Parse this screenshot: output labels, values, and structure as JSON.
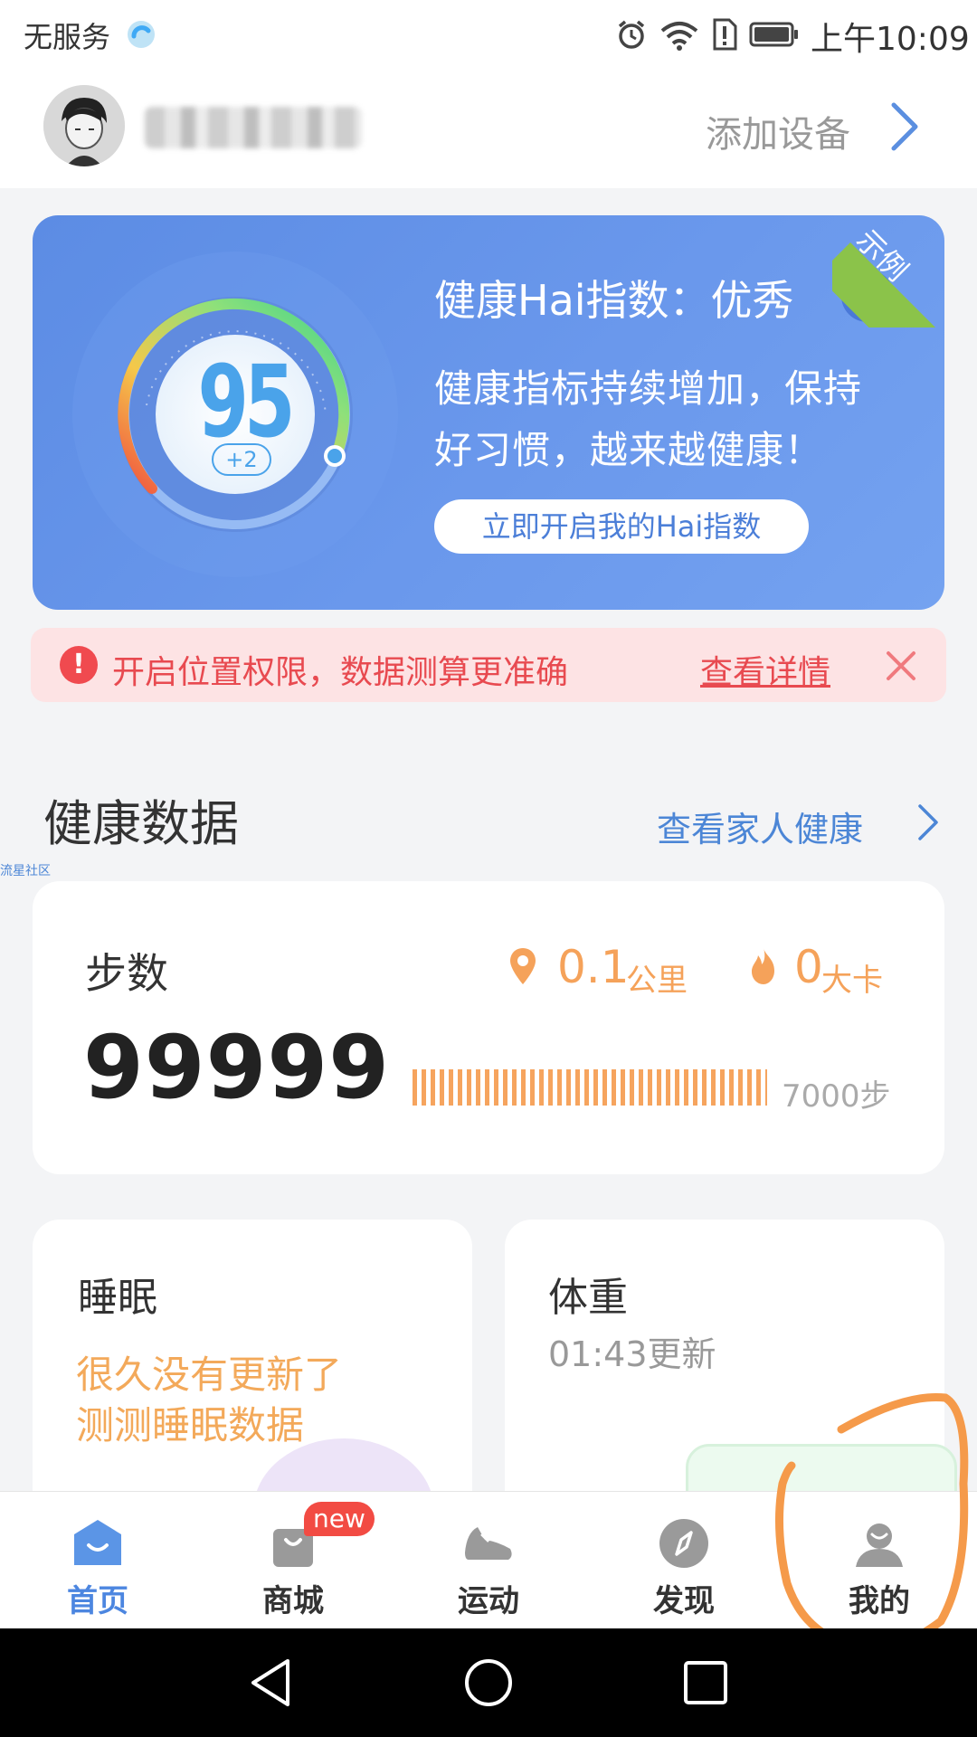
{
  "status_bar": {
    "carrier": "无服务",
    "time": "上午10:09",
    "icons": [
      "alarm-icon",
      "wifi-icon",
      "sim-alert-icon",
      "battery-icon"
    ]
  },
  "header": {
    "add_device_label": "添加设备"
  },
  "health_banner": {
    "score": "95",
    "score_delta": "+2",
    "title": "健康Hai指数：优秀",
    "desc_line1": "健康指标持续增加，保持",
    "desc_line2": "好习惯，越来越健康！",
    "button_label": "立即开启我的Hai指数",
    "ribbon_label": "示例",
    "colors": {
      "background": "#6a98ec",
      "ribbon": "#8bc34a",
      "score": "#4aa3ea"
    }
  },
  "alert": {
    "text": "开启位置权限，数据测算更准确",
    "link_label": "查看详情",
    "color": "#e84a50"
  },
  "section": {
    "title": "健康数据",
    "family_link": "查看家人健康",
    "watermark": "流星社区"
  },
  "steps": {
    "label": "步数",
    "value": "99999",
    "distance_value": "0.1",
    "distance_unit": "公里",
    "calories_value": "0",
    "calories_unit": "大卡",
    "goal_label": "7000步",
    "progress": 1.0
  },
  "sleep": {
    "title": "睡眠",
    "message_line1": "很久没有更新了",
    "message_line2": "测测睡眠数据"
  },
  "weight": {
    "title": "体重",
    "updated": "01:43更新"
  },
  "tabs": [
    {
      "label": "首页",
      "icon": "home-icon",
      "active": true
    },
    {
      "label": "商城",
      "icon": "shop-bag-icon",
      "active": false,
      "badge": "new"
    },
    {
      "label": "运动",
      "icon": "sneaker-icon",
      "active": false
    },
    {
      "label": "发现",
      "icon": "compass-icon",
      "active": false
    },
    {
      "label": "我的",
      "icon": "profile-icon",
      "active": false
    }
  ],
  "nav_bar": {
    "icons": [
      "back-icon",
      "home-circle-icon",
      "recents-icon"
    ]
  }
}
